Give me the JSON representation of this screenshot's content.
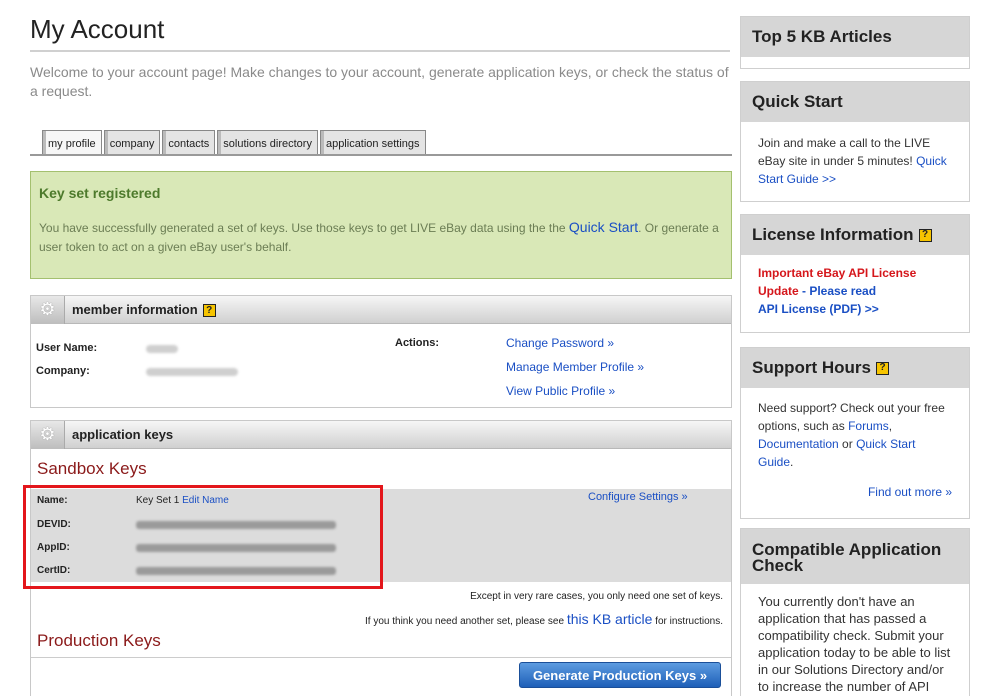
{
  "page": {
    "title": "My Account",
    "welcome": "Welcome to your account page! Make changes to your account, generate application keys, or check the status of a request."
  },
  "tabs": [
    "my profile",
    "company",
    "contacts",
    "solutions directory",
    "application settings"
  ],
  "alert": {
    "title": "Key set registered",
    "text_before": "You have successfully generated a set of keys. Use those keys to get LIVE eBay data using the the ",
    "link": "Quick Start",
    "text_after": ". Or generate a user token to act on a given eBay user's behalf."
  },
  "member": {
    "title": "member information",
    "help": "?",
    "user_name_label": "User Name:",
    "company_label": "Company:",
    "actions_label": "Actions:",
    "actions": [
      "Change Password »",
      "Manage Member Profile »",
      "View Public Profile »"
    ]
  },
  "appkeys": {
    "title": "application keys",
    "sandbox_title": "Sandbox Keys",
    "name_label": "Name:",
    "keyset_name": "Key Set 1",
    "edit_name": "Edit Name",
    "devid_label": "DEVID:",
    "appid_label": "AppID:",
    "certid_label": "CertID:",
    "configure": "Configure Settings »",
    "note1": "Except in very rare cases, you only need one set of keys.",
    "note2_before": "If you think you need another set, please see ",
    "note2_link": "this KB article",
    "note2_after": " for instructions.",
    "production_title": "Production Keys",
    "generate_button": "Generate Production Keys »"
  },
  "sidebar": {
    "top5": {
      "title": "Top 5 KB Articles"
    },
    "quickstart": {
      "title": "Quick Start",
      "text": "Join and make a call to the LIVE eBay site in under 5 minutes! ",
      "link": "Quick Start Guide >>"
    },
    "license": {
      "title": "License Information",
      "help": "?",
      "red_text": "Important eBay API License Update",
      "dash": " - ",
      "read_link": "Please read",
      "pdf_link": "API License (PDF) >>"
    },
    "support": {
      "title": "Support Hours",
      "help": "?",
      "text1": "Need support? Check out your free options, such as ",
      "forums": "Forums",
      "sep": ", ",
      "docs": "Documentation",
      "or": " or ",
      "qsg": "Quick Start Guide",
      "period": ".",
      "more": "Find out more »"
    },
    "compat": {
      "title": "Compatible Application Check",
      "text": "You currently don't have an application that has passed a compatibility check. Submit your application today to be able to list in our Solutions Directory and/or to increase the number of API"
    }
  }
}
